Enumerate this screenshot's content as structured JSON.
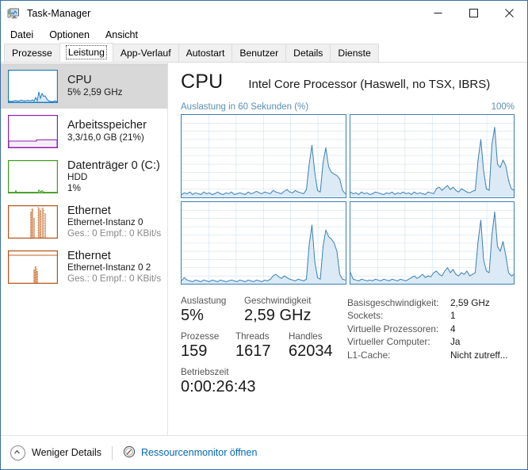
{
  "window": {
    "title": "Task-Manager",
    "icon": "task-manager-icon",
    "minimize_label": "—",
    "maximize_label": "□",
    "close_label": "✕"
  },
  "menubar": {
    "items": [
      {
        "label": "Datei"
      },
      {
        "label": "Optionen"
      },
      {
        "label": "Ansicht"
      }
    ]
  },
  "tabs": [
    {
      "label": "Prozesse",
      "active": false
    },
    {
      "label": "Leistung",
      "active": true
    },
    {
      "label": "App-Verlauf",
      "active": false
    },
    {
      "label": "Autostart",
      "active": false
    },
    {
      "label": "Benutzer",
      "active": false
    },
    {
      "label": "Details",
      "active": false
    },
    {
      "label": "Dienste",
      "active": false
    }
  ],
  "sidebar": {
    "items": [
      {
        "name": "cpu",
        "title": "CPU",
        "line2": "5% 2,59 GHz",
        "line3": "",
        "selected": true,
        "color": "#1f7ec2"
      },
      {
        "name": "memory",
        "title": "Arbeitsspeicher",
        "line2": "3,3/16,0 GB (21%)",
        "line3": "",
        "selected": false,
        "color": "#8a23a8"
      },
      {
        "name": "disk",
        "title": "Datenträger 0 (C:)",
        "line2": "HDD",
        "line3": "1%",
        "selected": false,
        "color": "#429a20"
      },
      {
        "name": "ethernet-0",
        "title": "Ethernet",
        "line2": "Ethernet-Instanz 0",
        "line3": "Ges.: 0 Empf.: 0 KBit/s",
        "selected": false,
        "color": "#b4531a"
      },
      {
        "name": "ethernet-0-2",
        "title": "Ethernet",
        "line2": "Ethernet-Instanz 0 2",
        "line3": "Ges.: 0 Empf.: 0 KBit/s",
        "selected": false,
        "color": "#b4531a"
      }
    ]
  },
  "main": {
    "title": "CPU",
    "subtitle": "Intel Core Processor (Haswell, no TSX, IBRS)",
    "graph_caption_left": "Auslastung in 60 Sekunden (%)",
    "graph_caption_right": "100%",
    "stats": {
      "utilization_label": "Auslastung",
      "utilization_value": "5%",
      "speed_label": "Geschwindigkeit",
      "speed_value": "2,59 GHz",
      "processes_label": "Prozesse",
      "processes_value": "159",
      "threads_label": "Threads",
      "threads_value": "1617",
      "handles_label": "Handles",
      "handles_value": "62034",
      "uptime_label": "Betriebszeit",
      "uptime_value": "0:00:26:43"
    },
    "details": [
      {
        "key": "Basisgeschwindigkeit:",
        "value": "2,59 GHz"
      },
      {
        "key": "Sockets:",
        "value": "1"
      },
      {
        "key": "Virtuelle Prozessoren:",
        "value": "4"
      },
      {
        "key": "Virtueller Computer:",
        "value": "Ja"
      },
      {
        "key": "L1-Cache:",
        "value": "Nicht zutreff..."
      }
    ]
  },
  "statusbar": {
    "less_details_label": "Weniger Details",
    "less_details_icon": "chevron-up-circle-icon",
    "resource_monitor_label": "Ressourcenmonitor öffnen",
    "resource_monitor_icon": "resource-monitor-icon"
  },
  "chart_data": {
    "type": "line",
    "title": "Auslastung in 60 Sekunden (%)",
    "xlabel": "60 Sekunden",
    "ylabel": "Auslastung (%)",
    "ylim": [
      0,
      100
    ],
    "xlim": [
      0,
      60
    ],
    "grid": true,
    "legend": "none",
    "accent_color": "#3b7fb5",
    "fill_color": "#dbeaf5",
    "panels": [
      {
        "name": "cpu-core-0",
        "values": [
          3,
          5,
          4,
          6,
          3,
          5,
          4,
          3,
          6,
          4,
          5,
          3,
          4,
          6,
          4,
          3,
          5,
          4,
          6,
          3,
          4,
          5,
          4,
          3,
          6,
          4,
          5,
          7,
          5,
          4,
          6,
          5,
          4,
          8,
          6,
          5,
          4,
          7,
          9,
          6,
          5,
          8,
          6,
          5,
          4,
          9,
          40,
          63,
          30,
          8,
          6,
          42,
          60,
          37,
          30,
          28,
          26,
          22,
          8,
          4
        ]
      },
      {
        "name": "cpu-core-1",
        "values": [
          6,
          4,
          5,
          3,
          6,
          4,
          5,
          3,
          4,
          6,
          5,
          4,
          3,
          5,
          4,
          6,
          3,
          5,
          4,
          6,
          4,
          5,
          3,
          6,
          4,
          5,
          4,
          3,
          6,
          5,
          4,
          10,
          12,
          8,
          11,
          14,
          9,
          12,
          8,
          6,
          10,
          8,
          6,
          5,
          7,
          8,
          45,
          70,
          32,
          10,
          8,
          64,
          85,
          40,
          36,
          45,
          38,
          20,
          10,
          8
        ]
      },
      {
        "name": "cpu-core-2",
        "values": [
          4,
          8,
          5,
          4,
          3,
          5,
          4,
          3,
          5,
          4,
          3,
          5,
          4,
          3,
          5,
          4,
          3,
          4,
          5,
          4,
          3,
          5,
          4,
          3,
          5,
          4,
          3,
          5,
          4,
          3,
          5,
          4,
          6,
          10,
          12,
          9,
          7,
          10,
          8,
          6,
          5,
          4,
          6,
          5,
          4,
          6,
          48,
          72,
          28,
          8,
          6,
          46,
          66,
          58,
          55,
          50,
          40,
          12,
          6,
          5
        ]
      },
      {
        "name": "cpu-core-3",
        "values": [
          14,
          6,
          5,
          4,
          6,
          5,
          4,
          5,
          4,
          6,
          5,
          4,
          6,
          5,
          4,
          6,
          5,
          4,
          6,
          5,
          4,
          6,
          8,
          10,
          7,
          9,
          12,
          8,
          10,
          9,
          14,
          16,
          12,
          10,
          16,
          20,
          14,
          18,
          12,
          10,
          14,
          12,
          16,
          10,
          12,
          14,
          52,
          78,
          30,
          16,
          14,
          60,
          88,
          46,
          40,
          52,
          35,
          14,
          10,
          12
        ]
      }
    ]
  }
}
